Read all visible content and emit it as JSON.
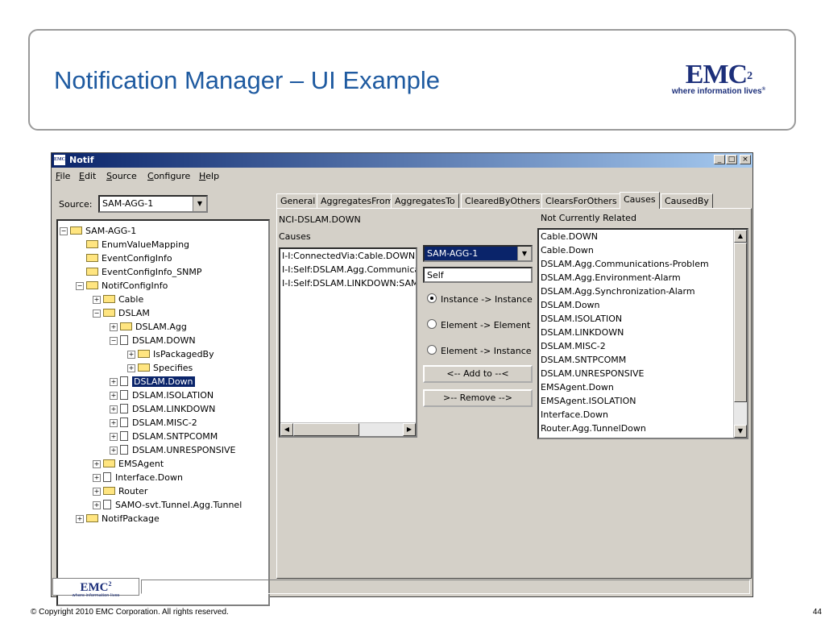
{
  "slide": {
    "title": "Notification Manager – UI Example",
    "logo": {
      "main": "EMC",
      "sup": "2",
      "tagline": "where information lives",
      "tm": "®"
    },
    "footer": {
      "copyright": "© Copyright 2010 EMC Corporation. All rights reserved.",
      "page": "44"
    }
  },
  "window": {
    "icon_text": "EMC",
    "title": "Notif",
    "controls": {
      "minimize": "_",
      "maximize": "□",
      "close": "×"
    },
    "menu": [
      {
        "key": "F",
        "rest": "ile"
      },
      {
        "key": "E",
        "rest": "dit"
      },
      {
        "key": "S",
        "rest": "ource"
      },
      {
        "key": "C",
        "rest": "onfigure"
      },
      {
        "key": "H",
        "rest": "elp"
      }
    ],
    "source": {
      "label": "Source:",
      "value": "SAM-AGG-1"
    },
    "tree": [
      {
        "label": "SAM-AGG-1",
        "type": "folder-open",
        "pm": "−"
      },
      {
        "label": "EnumValueMapping",
        "type": "folder",
        "pm": ""
      },
      {
        "label": "EventConfigInfo",
        "type": "folder",
        "pm": ""
      },
      {
        "label": "EventConfigInfo_SNMP",
        "type": "folder",
        "pm": ""
      },
      {
        "label": "NotifConfigInfo",
        "type": "folder-open",
        "pm": "−"
      },
      {
        "label": "Cable",
        "type": "folder",
        "pm": "+"
      },
      {
        "label": "DSLAM",
        "type": "folder-open",
        "pm": "−"
      },
      {
        "label": "DSLAM.Agg",
        "type": "folder",
        "pm": "+"
      },
      {
        "label": "DSLAM.DOWN",
        "type": "doc",
        "pm": "−"
      },
      {
        "label": "IsPackagedBy",
        "type": "folder",
        "pm": "+"
      },
      {
        "label": "Specifies",
        "type": "folder",
        "pm": "+"
      },
      {
        "label": "DSLAM.Down",
        "type": "doc",
        "pm": "+"
      },
      {
        "label": "DSLAM.ISOLATION",
        "type": "doc",
        "pm": "+"
      },
      {
        "label": "DSLAM.LINKDOWN",
        "type": "doc",
        "pm": "+"
      },
      {
        "label": "DSLAM.MISC-2",
        "type": "doc",
        "pm": "+"
      },
      {
        "label": "DSLAM.SNTPCOMM",
        "type": "doc",
        "pm": "+"
      },
      {
        "label": "DSLAM.UNRESPONSIVE",
        "type": "doc",
        "pm": "+"
      },
      {
        "label": "EMSAgent",
        "type": "folder",
        "pm": "+"
      },
      {
        "label": "Interface.Down",
        "type": "doc",
        "pm": "+"
      },
      {
        "label": "Router",
        "type": "folder",
        "pm": "+"
      },
      {
        "label": "SAMO-svt.Tunnel.Agg.Tunnel",
        "type": "doc",
        "pm": "+"
      },
      {
        "label": "NotifPackage",
        "type": "folder",
        "pm": "+"
      }
    ],
    "selected_tree_item": "DSLAM.Down",
    "tabs": [
      "General",
      "AggregatesFrom",
      "AggregatesTo",
      "ClearedByOthers",
      "ClearsForOthers",
      "Causes",
      "CausedBy"
    ],
    "active_tab": "Causes",
    "causes_panel": {
      "notification": "NCI-DSLAM.DOWN",
      "causes_label": "Causes",
      "causes": [
        "I-I:ConnectedVia:Cable.DOWN:S",
        "I-I:Self:DSLAM.Agg.Communicat",
        "I-I:Self:DSLAM.LINKDOWN:SAM-"
      ],
      "source_select": "SAM-AGG-1",
      "relationship_input": "Self",
      "radios": [
        {
          "label": "Instance -> Instance",
          "checked": true
        },
        {
          "label": "Element -> Element",
          "checked": false
        },
        {
          "label": "Element -> Instance",
          "checked": false
        }
      ],
      "add_button": "<-- Add to --<",
      "remove_button": ">-- Remove -->",
      "not_related_label": "Not Currently Related",
      "not_related": [
        "Cable.DOWN",
        "Cable.Down",
        "DSLAM.Agg.Communications-Problem",
        "DSLAM.Agg.Environment-Alarm",
        "DSLAM.Agg.Synchronization-Alarm",
        "DSLAM.Down",
        "DSLAM.ISOLATION",
        "DSLAM.LINKDOWN",
        "DSLAM.MISC-2",
        "DSLAM.SNTPCOMM",
        "DSLAM.UNRESPONSIVE",
        "EMSAgent.Down",
        "EMSAgent.ISOLATION",
        "Interface.Down",
        "Router.Agg.TunnelDown"
      ]
    },
    "status": {
      "logo_main": "EMC",
      "logo_sup": "2",
      "logo_tagline": "where information lives"
    },
    "colors": {
      "title_bar": "#0a246a",
      "selection": "#0a246a",
      "slide_title": "#1e5aa0",
      "logo": "#1c2f7a"
    }
  }
}
